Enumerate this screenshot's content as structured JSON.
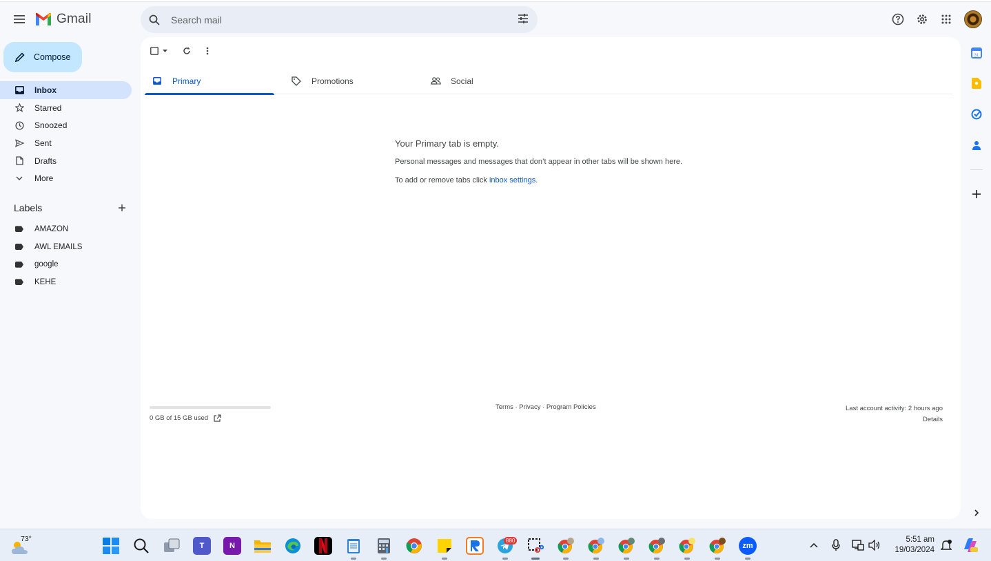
{
  "app": {
    "name": "Gmail"
  },
  "search": {
    "placeholder": "Search mail"
  },
  "sidebar": {
    "compose_label": "Compose",
    "nav": [
      {
        "label": "Inbox",
        "icon": "inbox-icon",
        "active": true
      },
      {
        "label": "Starred",
        "icon": "star-icon"
      },
      {
        "label": "Snoozed",
        "icon": "clock-icon"
      },
      {
        "label": "Sent",
        "icon": "send-icon"
      },
      {
        "label": "Drafts",
        "icon": "draft-icon"
      },
      {
        "label": "More",
        "icon": "chevron-down-icon"
      }
    ],
    "labels_heading": "Labels",
    "labels": [
      "AMAZON",
      "AWL EMAILS",
      "google",
      "KEHE"
    ]
  },
  "tabs": [
    {
      "label": "Primary",
      "icon": "inbox-icon",
      "active": true
    },
    {
      "label": "Promotions",
      "icon": "tag-icon"
    },
    {
      "label": "Social",
      "icon": "people-icon"
    }
  ],
  "empty_state": {
    "title": "Your Primary tab is empty.",
    "line1": "Personal messages and messages that don’t appear in other tabs will be shown here.",
    "line2_prefix": "To add or remove tabs click ",
    "line2_link": "inbox settings",
    "line2_suffix": "."
  },
  "footer": {
    "storage_text": "0 GB of 15 GB used",
    "storage_fraction": 0.0,
    "links": "Terms · Privacy · Program Policies",
    "activity": "Last account activity: 2 hours ago",
    "details": "Details"
  },
  "taskbar": {
    "weather_temp": "73°",
    "telegram_badge": "880",
    "zoom_label": "zm",
    "time": "5:51 am",
    "date": "19/03/2024"
  },
  "colors": {
    "accent": "#0b57d0",
    "compose_bg": "#c2e7ff",
    "active_nav_bg": "#d3e3fd",
    "page_bg": "#f6f8fc"
  }
}
